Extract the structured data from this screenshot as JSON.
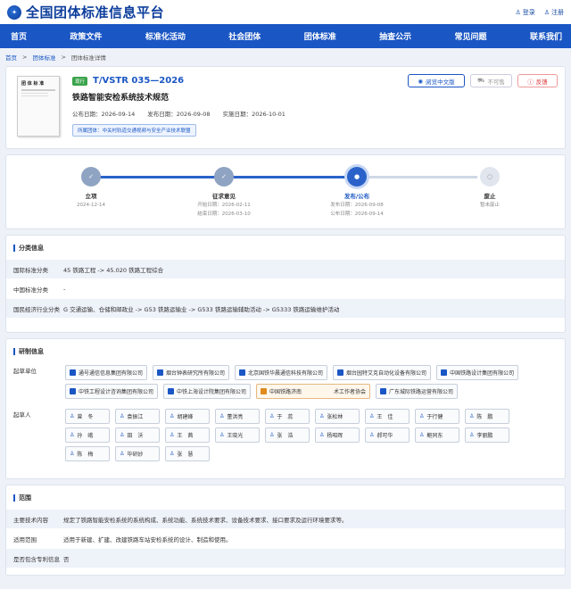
{
  "header": {
    "site_title": "全国团体标准信息平台",
    "login": "登录",
    "register": "注册"
  },
  "nav": [
    "首页",
    "政策文件",
    "标准化活动",
    "社会团体",
    "团体标准",
    "抽查公示",
    "常见问题",
    "联系我们"
  ],
  "breadcrumb": [
    "首页",
    "团体标准",
    "团体标准详情"
  ],
  "standard": {
    "status": "现行",
    "code": "T/VSTR 035—2026",
    "name": "铁路智能安检系统技术规范",
    "publish_notice": "公布日期：2026-09-14",
    "release_date": "发布日期：2026-09-08",
    "impl_date": "实施日期：2026-10-01",
    "org": "所属团体：中关村轨道交通视频与安全产业技术联盟",
    "thumb_title": "团 体 标 准",
    "read_btn": "阅览中文版",
    "buy_btn": "不可售",
    "feedback_btn": "反馈"
  },
  "timeline": [
    {
      "label": "立项",
      "l1": "2024-12-14",
      "l2": "",
      "state": "done",
      "icon": "✓"
    },
    {
      "label": "征求意见",
      "l1": "开始日期：2026-02-11",
      "l2": "结束日期：2026-03-10",
      "state": "done",
      "icon": "✓"
    },
    {
      "label": "发布/公布",
      "l1": "发布日期：2026-09-08",
      "l2": "公布日期：2026-09-14",
      "state": "cur",
      "icon": "●"
    },
    {
      "label": "废止",
      "l1": "暂未废止",
      "l2": "",
      "state": "todo",
      "icon": "○"
    }
  ],
  "classification": {
    "title": "分类信息",
    "rows": [
      {
        "k": "国际标准分类",
        "v": "45 铁路工程 -> 45.020 铁路工程综合"
      },
      {
        "k": "中国标准分类",
        "v": "-"
      },
      {
        "k": "国民经济行业分类",
        "v": "G 交通运输、仓储和邮政业 -> G53 铁路运输业 -> G533 铁路运输辅助活动 -> G5333 铁路运输维护活动"
      }
    ]
  },
  "drafting": {
    "title": "研制信息",
    "units_label": "起草单位",
    "units": [
      {
        "name": "通号通信信息集团有限公司",
        "warn": false
      },
      {
        "name": "烟台钟表研究所有限公司",
        "warn": false
      },
      {
        "name": "北京国铁华晨通信科技有限公司",
        "warn": false
      },
      {
        "name": "烟台园特艾克自动化设备有限公司",
        "warn": false
      },
      {
        "name": "中国铁路设计集团有限公司",
        "warn": false
      },
      {
        "name": "中铁工程设计咨询集团有限公司",
        "warn": false
      },
      {
        "name": "中铁上海设计院集团有限公司",
        "warn": false
      },
      {
        "name": "中国铁路济南　　　　　　术工作者协会",
        "warn": true
      },
      {
        "name": "广东城际铁路运营有限公司",
        "warn": false
      }
    ],
    "people_label": "起草人",
    "people": [
      "曾　冬",
      "袁振江",
      "胡建峰",
      "董洪亮",
      "于　蕊",
      "张松林",
      "王　佳",
      "于行健",
      "陈　鹏",
      "孙　峨",
      "田　沃",
      "王　茜",
      "王晓光",
      "张　浩",
      "杨昭晖",
      "郝可华",
      "鲍同东",
      "李丽鹏",
      "陈　梅",
      "毕研妙",
      "张　慧"
    ]
  },
  "scope": {
    "title": "范围",
    "rows": [
      {
        "k": "主要技术内容",
        "v": "规定了铁路智能安检系统的系统构成、系统功能、系统技术要求、设备技术要求、接口要求及运行环境要求等。"
      },
      {
        "k": "适用范围",
        "v": "适用于新建、扩建、改建铁路车站安检系统的设计、制造和使用。"
      },
      {
        "k": "是否包含专利信息",
        "v": "否"
      }
    ]
  }
}
